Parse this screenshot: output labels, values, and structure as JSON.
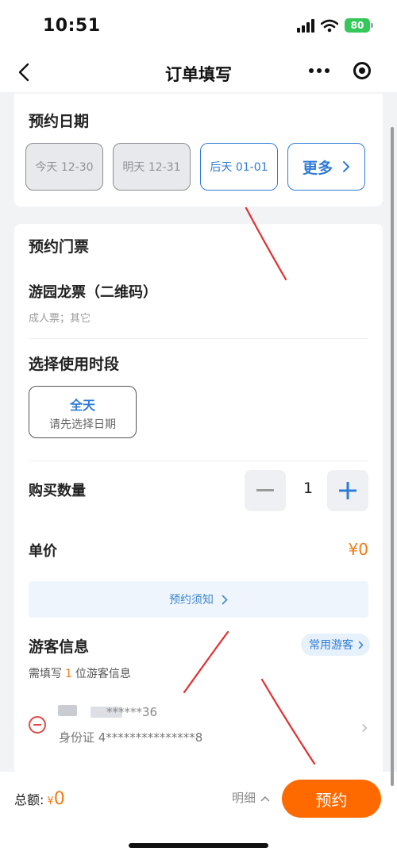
{
  "status_bar": {
    "time": "10:51",
    "battery": "80"
  },
  "nav": {
    "title": "订单填写"
  },
  "date_section": {
    "title": "预约日期",
    "chips": [
      {
        "label": "今天 12-30",
        "state": "disabled"
      },
      {
        "label": "明天 12-31",
        "state": "disabled"
      },
      {
        "label": "后天 01-01",
        "state": "selected"
      }
    ],
    "more_label": "更多"
  },
  "ticket_section": {
    "title": "预约门票",
    "ticket_name": "游园龙票（二维码）",
    "ticket_sub": "成人票；其它"
  },
  "period_section": {
    "title": "选择使用时段",
    "option_main": "全天",
    "option_sub": "请先选择日期"
  },
  "quantity": {
    "label": "购买数量",
    "value": "1"
  },
  "unit_price": {
    "label": "单价",
    "value": "¥0"
  },
  "notice": {
    "label": "预约须知"
  },
  "visitor_section": {
    "title": "游客信息",
    "common_button": "常用游客",
    "hint_prefix": "需填写",
    "hint_count": "1",
    "hint_suffix": "位游客信息",
    "visitor": {
      "name_masked": "******36",
      "id_text": "身份证 4***************8"
    }
  },
  "bottom_bar": {
    "total_label": "总额:",
    "total_currency": "¥",
    "total_value": "0",
    "detail_label": "明细",
    "book_label": "预约"
  },
  "colors": {
    "primary_blue": "#2f7bd6",
    "accent_orange": "#ff6a00",
    "price_orange": "#f07b16",
    "annotation_red": "#e03030"
  }
}
